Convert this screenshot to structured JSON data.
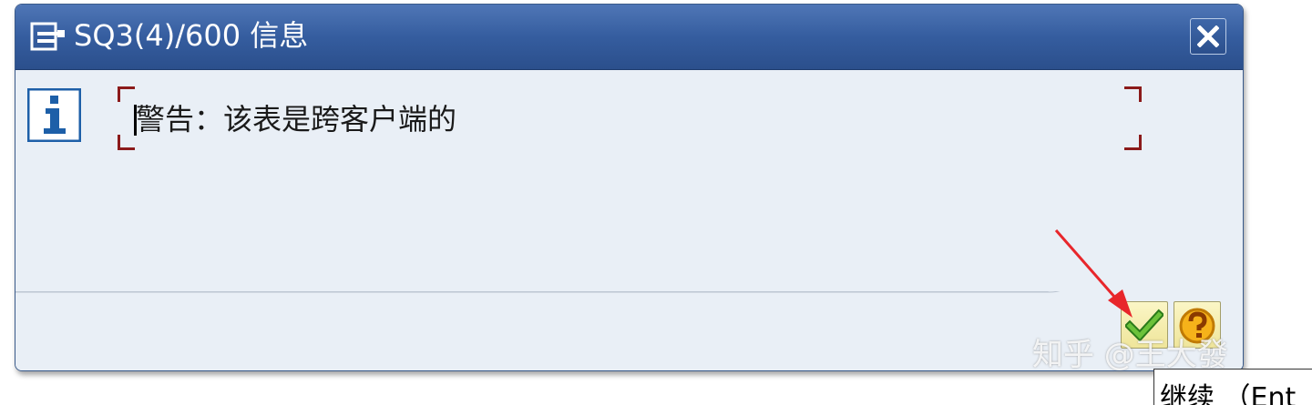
{
  "dialog": {
    "title": "SQ3(4)/600 信息",
    "title_icon": "window-menu-icon",
    "close_icon": "close-icon"
  },
  "message": {
    "icon": "info-icon",
    "text": "警告：该表是跨客户端的"
  },
  "buttons": {
    "continue_icon": "checkmark-icon",
    "help_icon": "help-icon"
  },
  "tooltip": {
    "text": "继续 （Ent"
  },
  "watermark": {
    "text": "知乎 @王大發"
  },
  "annotation": {
    "arrow_color": "#e8262b"
  },
  "colors": {
    "title_bar": "#355d9f",
    "body_bg": "#e9eff6",
    "frame_corner": "#8b1a1a",
    "button_bg": "#f5eeb0"
  }
}
